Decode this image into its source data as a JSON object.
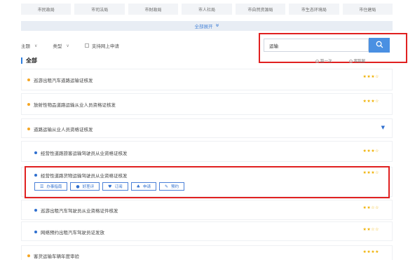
{
  "departments": [
    "市民政局",
    "市司法局",
    "市财政局",
    "市人社局",
    "市自然资源局",
    "市生态环境局",
    "市住建局"
  ],
  "expand_label": "全部展开",
  "filters": {
    "theme_label": "主题",
    "type_label": "类型",
    "online_label": "支持网上申请"
  },
  "search": {
    "value": "运输"
  },
  "section_title": "全部",
  "legend": {
    "once": "跑一次",
    "zero": "零跑腿"
  },
  "items": [
    {
      "label": "巡游出租汽车道路运输证核发",
      "stars": "★★★☆",
      "level": "top"
    },
    {
      "label": "放射性物品道路运输从业人员资格证核发",
      "stars": "★★★☆",
      "level": "top"
    },
    {
      "label": "道路运输从业人员资格证核发",
      "stars": "",
      "level": "top",
      "expanded": true
    },
    {
      "label": "经营性道路旅客运输驾驶员从业资格证核发",
      "stars": "★★★☆",
      "level": "sub"
    },
    {
      "label": "经营性道路货物运输驾驶员从业资格证核发",
      "stars": "★★★☆",
      "level": "sub"
    },
    {
      "label": "巡游出租汽车驾驶员从业资格证件核发",
      "stars": "★★☆☆",
      "level": "sub"
    },
    {
      "label": "网络预约出租汽车驾驶员证发放",
      "stars": "★★☆☆",
      "level": "sub"
    },
    {
      "label": "客货运输车辆年度审验",
      "stars": "★★★★",
      "level": "top"
    }
  ],
  "actions": {
    "guide": "办事指南",
    "review": "好差评",
    "subscribe": "订阅",
    "apply": "申请",
    "reserve": "预约"
  }
}
